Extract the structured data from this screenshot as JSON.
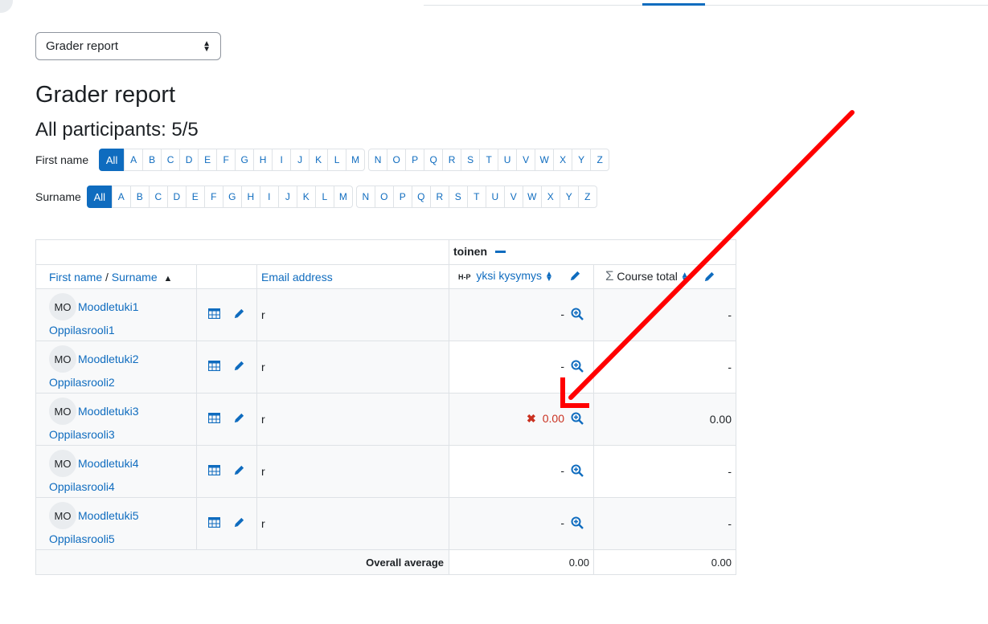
{
  "report_select": {
    "value": "Grader report"
  },
  "page_title": "Grader report",
  "participants": "All participants: 5/5",
  "filters": {
    "first_name_label": "First name",
    "surname_label": "Surname",
    "all_label": "All",
    "letters": [
      "A",
      "B",
      "C",
      "D",
      "E",
      "F",
      "G",
      "H",
      "I",
      "J",
      "K",
      "L",
      "M",
      "N",
      "O",
      "P",
      "Q",
      "R",
      "S",
      "T",
      "U",
      "V",
      "W",
      "X",
      "Y",
      "Z"
    ]
  },
  "table": {
    "category": "toinen",
    "col_firstname": "First name",
    "col_sep": " / ",
    "col_surname": "Surname",
    "col_email": "Email address",
    "col_item_badge": "H-P",
    "col_item": "yksi kysymys",
    "col_total": "Course total",
    "rows": [
      {
        "initials": "MO",
        "first": "Moodletuki1",
        "last": "Oppilasrooli1",
        "email": "r",
        "grade": "-",
        "total": "-",
        "overridden": false
      },
      {
        "initials": "MO",
        "first": "Moodletuki2",
        "last": "Oppilasrooli2",
        "email": "r",
        "grade": "-",
        "total": "-",
        "overridden": false
      },
      {
        "initials": "MO",
        "first": "Moodletuki3",
        "last": "Oppilasrooli3",
        "email": "r",
        "grade": "0.00",
        "total": "0.00",
        "overridden": true
      },
      {
        "initials": "MO",
        "first": "Moodletuki4",
        "last": "Oppilasrooli4",
        "email": "r",
        "grade": "-",
        "total": "-",
        "overridden": false
      },
      {
        "initials": "MO",
        "first": "Moodletuki5",
        "last": "Oppilasrooli5",
        "email": "r",
        "grade": "-",
        "total": "-",
        "overridden": false
      }
    ],
    "avg_label": "Overall average",
    "avg_item": "0.00",
    "avg_total": "0.00"
  },
  "colors": {
    "accent": "#0f6cbf",
    "danger": "#ca3120",
    "arrow": "#ff0000"
  }
}
